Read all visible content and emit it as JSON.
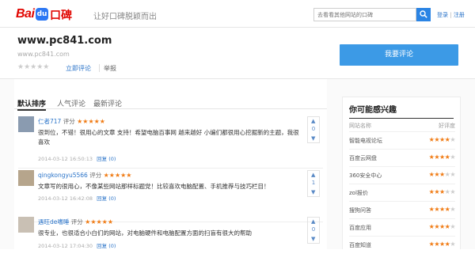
{
  "header": {
    "logo_bai": "Bai",
    "logo_du": "du",
    "logo_koubei": "口碑",
    "slogan": "让好口碑脱颖而出",
    "search_placeholder": "去看看其他网站的口碑",
    "login": "登录",
    "separator": "|",
    "register": "注册"
  },
  "site": {
    "title": "www.pc841.com",
    "url": "www.pc841.com",
    "stars": "★★★★★",
    "rate_link": "立即评论",
    "report_link": "举报",
    "review_button": "我要评论"
  },
  "tabs": [
    "默认排序",
    "人气评论",
    "最新评论"
  ],
  "reviews": [
    {
      "user": "仁者717",
      "score_label": "评分",
      "stars": "★★★★★",
      "text": "很到位，不错！很用心的文章 支持！希望电脑百事网 越来越好 小编们都很用心挖掘新的主题，我很喜欢",
      "time": "2014-03-12 16:50:13",
      "reply": "回复 (0)",
      "votes": "0",
      "avatar_color": "#8a9bb0"
    },
    {
      "user": "qingkongyu5566",
      "score_label": "评分",
      "stars": "★★★★★",
      "text": "文章写的很用心，不像某些网站那样标题党！比较喜欢电脑配置、手机推荐与技巧栏目！",
      "time": "2014-03-12 16:42:08",
      "reply": "回复 (0)",
      "votes": "1",
      "avatar_color": "#b6a58c"
    },
    {
      "user": "遇旺de嗜睡",
      "score_label": "评分",
      "stars": "★★★★★",
      "text": "很专业，也很适合小白们的网站，对电脑硬件和电脑配置方面的扫盲有很大的帮助",
      "time": "2014-03-12 17:04:30",
      "reply": "回复 (0)",
      "votes": "0",
      "avatar_color": "#c9c0b4"
    }
  ],
  "sidebar": {
    "title": "你可能感兴趣",
    "col_name": "网站名称",
    "col_rating": "好评度",
    "items": [
      {
        "name": "智能电视论坛",
        "stars_on": "★★★★",
        "stars_off": "★"
      },
      {
        "name": "百度云网盘",
        "stars_on": "★★★★",
        "stars_off": "★"
      },
      {
        "name": "360安全中心",
        "stars_on": "★★★",
        "stars_off": "★★"
      },
      {
        "name": "zol报价",
        "stars_on": "★★★",
        "stars_off": "★★"
      },
      {
        "name": "搜狗问答",
        "stars_on": "★★★★",
        "stars_off": "★"
      },
      {
        "name": "百度应用",
        "stars_on": "★★★★",
        "stars_off": "★"
      },
      {
        "name": "百度知道",
        "stars_on": "★★★★",
        "stars_off": "★"
      }
    ]
  },
  "colors": {
    "accent_blue": "#3c9ae6",
    "link_blue": "#2b74c9",
    "star_orange": "#f07b14",
    "brand_red": "#e10601"
  }
}
